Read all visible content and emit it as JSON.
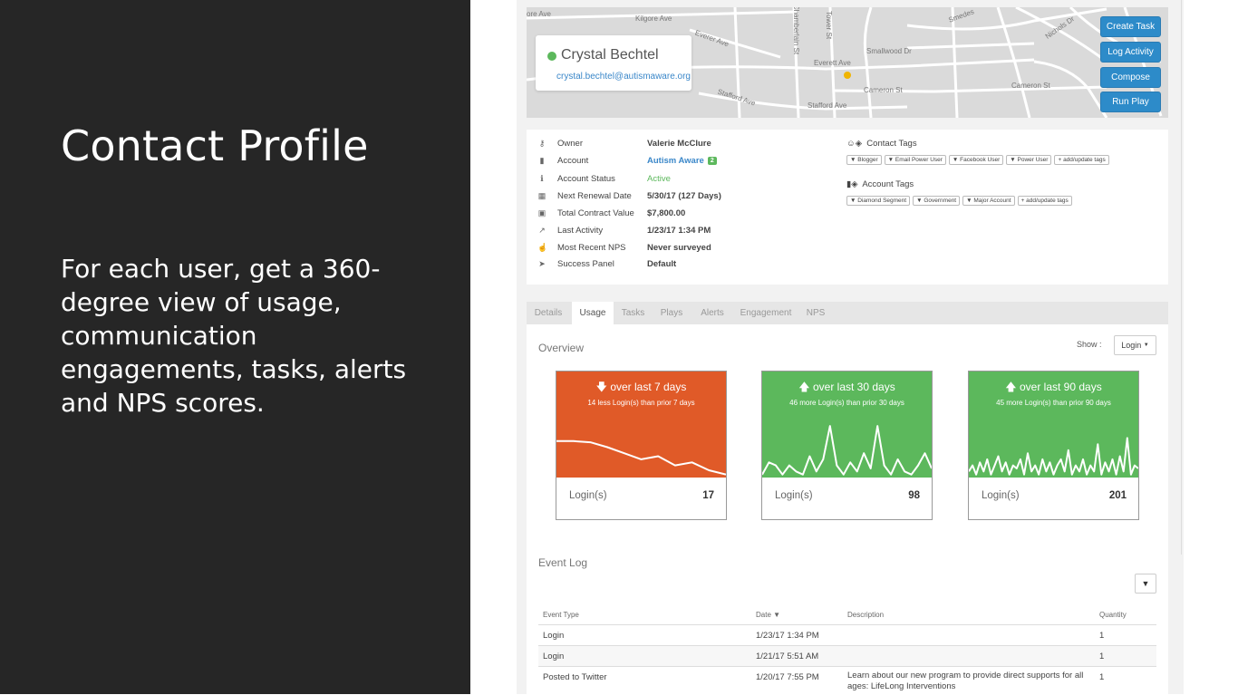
{
  "slide": {
    "title": "Contact Profile",
    "description": "For each user, get a 360-degree view of usage, communication engagements, tasks, alerts and NPS scores."
  },
  "map": {
    "streets": [
      "Kilgore Ave",
      "Everer Ave",
      "Everett Ave",
      "Smallwood Dr",
      "Cameron St",
      "Cameron St",
      "Stafford Ave",
      "Stafford Ave",
      "Chamberlain St",
      "Tower St",
      "Smedes",
      "Nichols Dr",
      "ore Ave"
    ],
    "contact_name": "Crystal Bechtel",
    "contact_email": "crystal.bechtel@autismaware.org",
    "status_color": "#5cb85c",
    "buttons": [
      "Create Task",
      "Log Activity",
      "Compose",
      "Run Play"
    ]
  },
  "info": {
    "fields": [
      {
        "icon": "key-icon",
        "label": "Owner",
        "value": "Valerie McClure"
      },
      {
        "icon": "building-icon",
        "label": "Account",
        "value": "Autism Aware",
        "badge": "2"
      },
      {
        "icon": "info-icon",
        "label": "Account Status",
        "value": "Active"
      },
      {
        "icon": "calendar-icon",
        "label": "Next Renewal Date",
        "value": "5/30/17 (127 Days)"
      },
      {
        "icon": "money-icon",
        "label": "Total Contract Value",
        "value": "$7,800.00"
      },
      {
        "icon": "line-chart-icon",
        "label": "Last Activity",
        "value": "1/23/17 1:34 PM"
      },
      {
        "icon": "thumbs-up-icon",
        "label": "Most Recent NPS",
        "value": "Never surveyed"
      },
      {
        "icon": "paper-plane-icon",
        "label": "Success Panel",
        "value": "Default"
      }
    ],
    "contact_tags_title": "Contact Tags",
    "contact_tags": [
      "Blogger",
      "Email Power User",
      "Facebook User",
      "Power User"
    ],
    "add_tags_label": "+ add/update tags",
    "account_tags_title": "Account Tags",
    "account_tags": [
      "Diamond Segment",
      "Government",
      "Major Account"
    ]
  },
  "tabs": [
    "Details",
    "Usage",
    "Tasks",
    "Plays",
    "Alerts",
    "Engagement",
    "NPS"
  ],
  "active_tab": "Usage",
  "usage": {
    "overview_title": "Overview",
    "show_label": "Show :",
    "show_value": "Login",
    "cards": [
      {
        "heading": "over last 7 days",
        "direction": "down",
        "subtitle": "14 less Login(s) than prior 7 days",
        "label": "Login(s)",
        "value": "17",
        "color": "#e05a28",
        "trend": [
          0.6,
          0.6,
          0.58,
          0.5,
          0.4,
          0.3,
          0.35,
          0.2,
          0.25,
          0.12,
          0.05
        ]
      },
      {
        "heading": "over last 30 days",
        "direction": "up",
        "subtitle": "46 more Login(s) than prior 30 days",
        "label": "Login(s)",
        "value": "98",
        "color": "#5cb85c",
        "trend": [
          0.05,
          0.25,
          0.2,
          0.05,
          0.2,
          0.1,
          0.05,
          0.35,
          0.1,
          0.3,
          0.85,
          0.2,
          0.05,
          0.25,
          0.1,
          0.4,
          0.15,
          0.85,
          0.2,
          0.05,
          0.3,
          0.1,
          0.05,
          0.2,
          0.4,
          0.15
        ]
      },
      {
        "heading": "over last 90 days",
        "direction": "up",
        "subtitle": "45 more Login(s) than prior 90 days",
        "label": "Login(s)",
        "value": "201",
        "color": "#5cb85c",
        "trend": [
          0.1,
          0.2,
          0.05,
          0.25,
          0.1,
          0.3,
          0.05,
          0.2,
          0.35,
          0.1,
          0.25,
          0.05,
          0.2,
          0.15,
          0.3,
          0.05,
          0.4,
          0.1,
          0.2,
          0.05,
          0.3,
          0.1,
          0.25,
          0.05,
          0.2,
          0.3,
          0.1,
          0.45,
          0.05,
          0.2,
          0.1,
          0.3,
          0.05,
          0.2,
          0.1,
          0.55,
          0.05,
          0.25,
          0.1,
          0.3,
          0.05,
          0.35,
          0.1,
          0.65,
          0.05,
          0.2,
          0.15
        ]
      }
    ]
  },
  "event_log": {
    "title": "Event Log",
    "columns": [
      "Event Type",
      "Date ▼",
      "Description",
      "Quantity"
    ],
    "rows": [
      {
        "type": "Login",
        "date": "1/23/17 1:34 PM",
        "description": "",
        "quantity": "1"
      },
      {
        "type": "Login",
        "date": "1/21/17 5:51 AM",
        "description": "",
        "quantity": "1"
      },
      {
        "type": "Posted to Twitter",
        "date": "1/20/17 7:55 PM",
        "description": "Learn about our new program to provide direct supports for all ages: LifeLong Interventions",
        "quantity": "1"
      }
    ]
  }
}
